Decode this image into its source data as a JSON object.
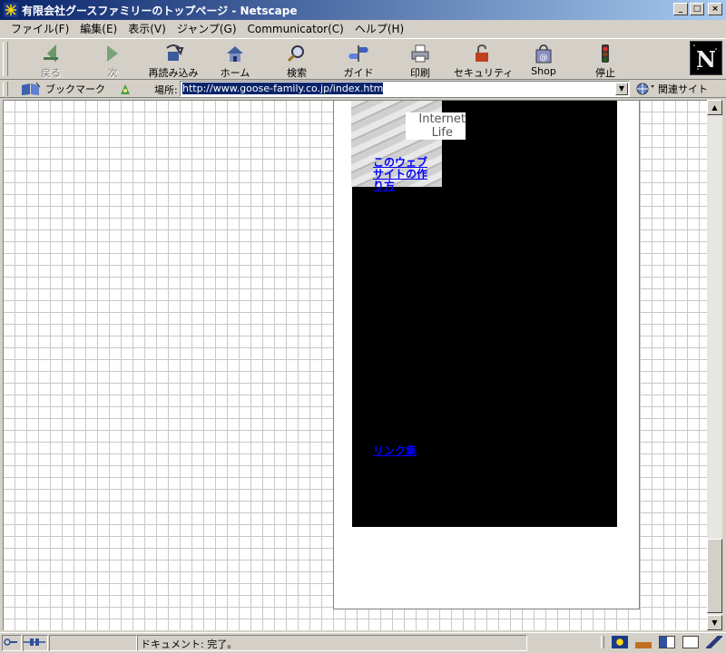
{
  "window": {
    "title": "有限会社グースファミリーのトップページ - Netscape",
    "controls": [
      "minimize",
      "maximize",
      "close"
    ]
  },
  "menubar": {
    "items": [
      "ファイル(F)",
      "編集(E)",
      "表示(V)",
      "ジャンプ(G)",
      "Communicator(C)",
      "ヘルプ(H)"
    ]
  },
  "toolbar": {
    "buttons": [
      {
        "label": "戻る",
        "icon": "back-arrow-icon",
        "enabled": false
      },
      {
        "label": "次",
        "icon": "forward-arrow-icon",
        "enabled": false
      },
      {
        "label": "再読み込み",
        "icon": "reload-icon",
        "enabled": true
      },
      {
        "label": "ホーム",
        "icon": "home-icon",
        "enabled": true
      },
      {
        "label": "検索",
        "icon": "search-icon",
        "enabled": true
      },
      {
        "label": "ガイド",
        "icon": "guide-icon",
        "enabled": true
      },
      {
        "label": "印刷",
        "icon": "print-icon",
        "enabled": true
      },
      {
        "label": "セキュリティ",
        "icon": "security-lock-icon",
        "enabled": true
      },
      {
        "label": "Shop",
        "icon": "shop-bag-icon",
        "enabled": true
      },
      {
        "label": "停止",
        "icon": "stop-icon",
        "enabled": true
      }
    ]
  },
  "locationbar": {
    "bookmarks_label": "ブックマーク",
    "location_label": "場所:",
    "url": "http://www.goose-family.co.jp/index.htm",
    "related_label": "関連サイト"
  },
  "page": {
    "header_image_text_line1": "Internet",
    "header_image_text_line2": "Life",
    "link_site_making": "このウェブサイトの作り方",
    "link_links": "リンク集"
  },
  "status": {
    "text": "ドキュメント: 完了。"
  },
  "colors": {
    "titlebar_start": "#0a246a",
    "titlebar_end": "#a6caf0",
    "chrome": "#d4d0c8",
    "link": "#0000ff",
    "panel": "#000000"
  }
}
